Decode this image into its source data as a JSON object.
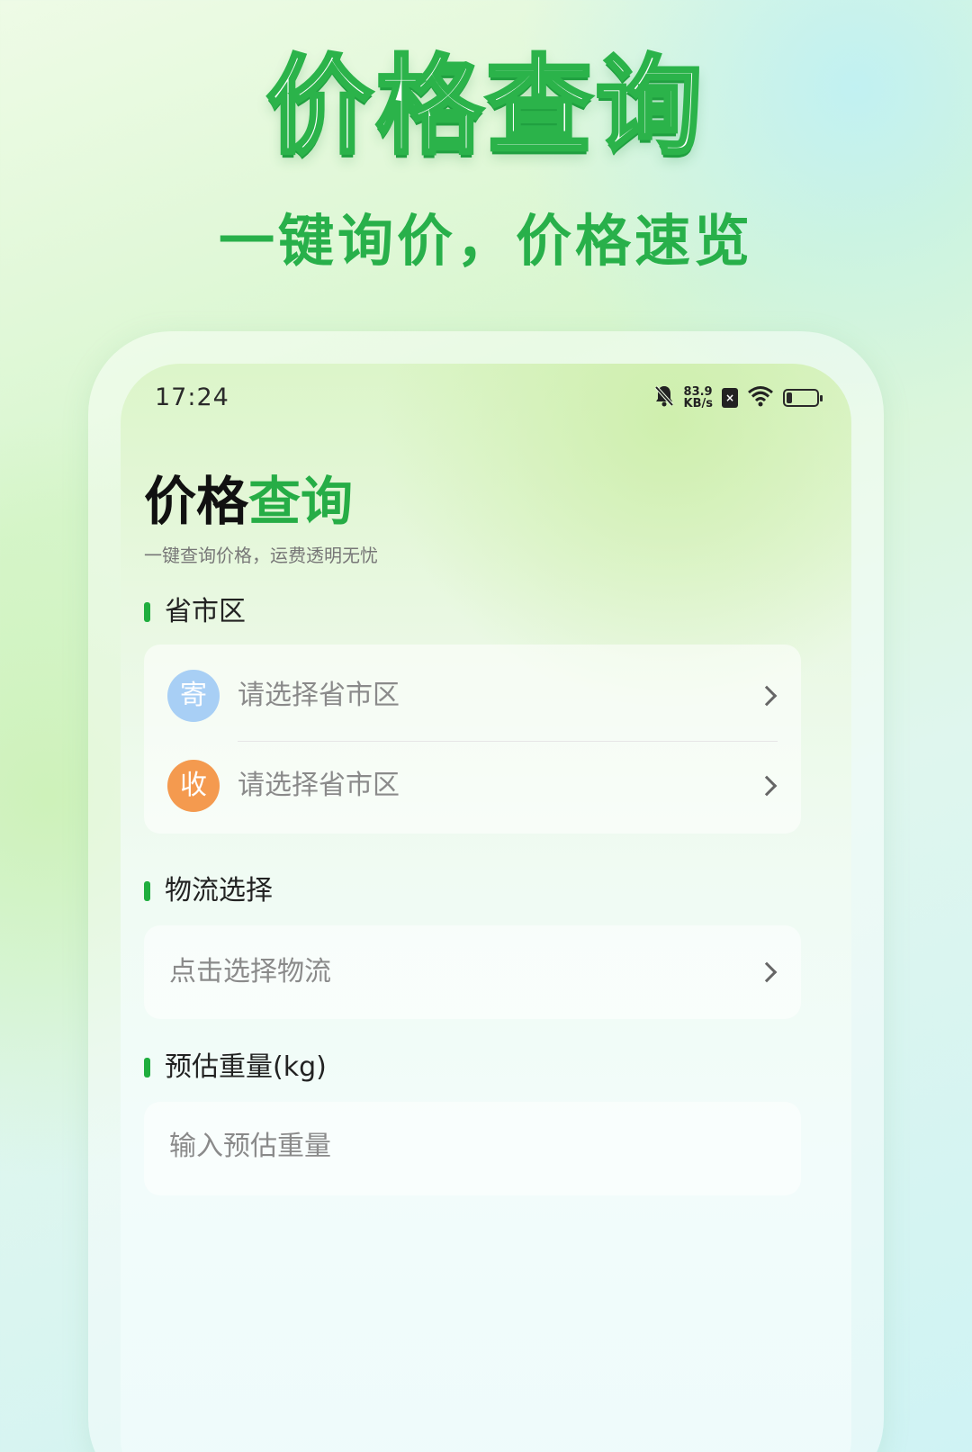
{
  "promo": {
    "title": "价格查询",
    "subtitle": "一键询价，价格速览"
  },
  "status_bar": {
    "time": "17:24",
    "net_speed_value": "83.9",
    "net_speed_unit": "KB/s",
    "sim_label": "×",
    "icons": [
      "bell-muted-icon",
      "sim-icon",
      "wifi-icon",
      "battery-icon"
    ]
  },
  "page": {
    "title_main": "价格",
    "title_accent": "查询",
    "subtitle": "一键查询价格，运费透明无忧"
  },
  "sections": {
    "region": {
      "label": "省市区",
      "send": {
        "badge": "寄",
        "placeholder": "请选择省市区"
      },
      "receive": {
        "badge": "收",
        "placeholder": "请选择省市区"
      }
    },
    "logistics": {
      "label": "物流选择",
      "placeholder": "点击选择物流"
    },
    "weight": {
      "label": "预估重量(kg)",
      "placeholder": "输入预估重量"
    }
  },
  "colors": {
    "accent_green": "#26ad46",
    "send_badge": "#a8cff5",
    "receive_badge": "#f49a4f"
  }
}
